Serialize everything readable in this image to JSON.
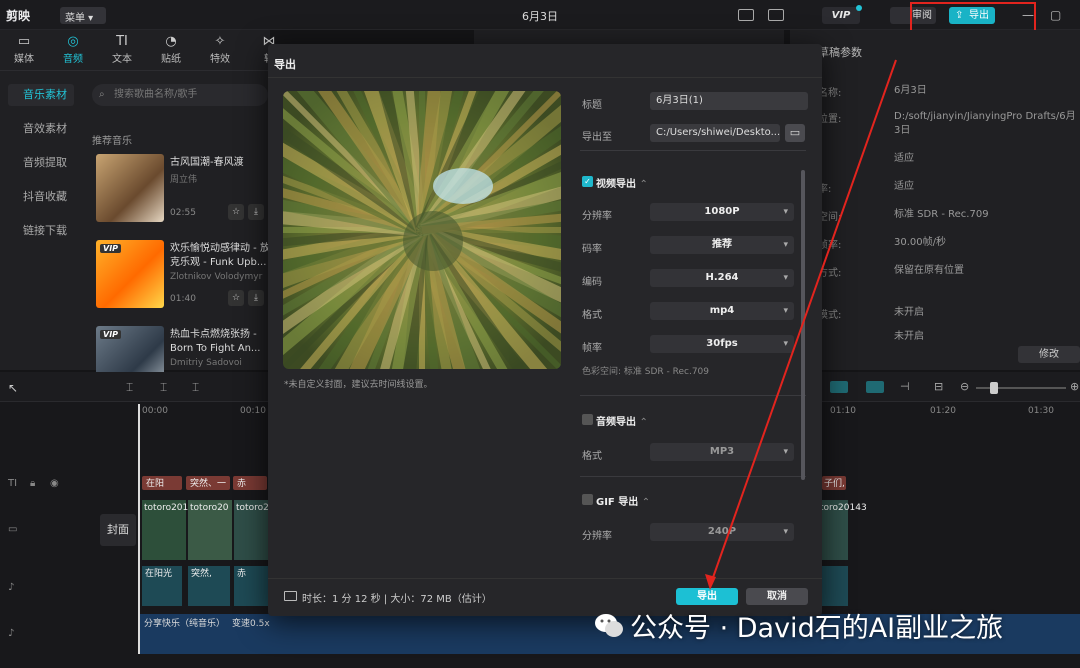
{
  "app": {
    "title": "6月3日",
    "logo": "剪映",
    "menu_label": "菜单",
    "vip_label": "VIP",
    "review_label": "审阅",
    "export_label": "导出",
    "accent": "#22c3d6",
    "highlight_red": "#e2241e"
  },
  "toolbar": {
    "tools": [
      {
        "label": "媒体",
        "icon": "media-icon"
      },
      {
        "label": "音频",
        "icon": "audio-icon"
      },
      {
        "label": "文本",
        "icon": "text-icon"
      },
      {
        "label": "贴纸",
        "icon": "sticker-icon"
      },
      {
        "label": "特效",
        "icon": "effects-icon"
      },
      {
        "label": "转",
        "icon": "transition-icon"
      }
    ]
  },
  "sidebar": {
    "items": [
      {
        "label": "音乐素材"
      },
      {
        "label": "音效素材"
      },
      {
        "label": "音频提取"
      },
      {
        "label": "抖音收藏"
      },
      {
        "label": "链接下载"
      }
    ]
  },
  "music": {
    "search_placeholder": "搜索歌曲名称/歌手",
    "section_title": "推荐音乐",
    "items": [
      {
        "title": "古风国潮-春风渡",
        "artist": "周立伟",
        "duration": "02:55",
        "vip": ""
      },
      {
        "title": "欢乐愉悦动感律动 - 放克乐观 - Funk Upb...",
        "artist": "Zlotnikov Volodymyr",
        "duration": "01:40",
        "vip": "VIP"
      },
      {
        "title": "热血卡点燃烧张扬 - Born To Fight An...",
        "artist": "Dmitriy Sadovoi",
        "duration": "",
        "vip": "VIP"
      }
    ]
  },
  "right_panel": {
    "title": "草稿参数",
    "rows": [
      {
        "label": "名称:",
        "value": "6月3日"
      },
      {
        "label": "位置:",
        "value": "D:/soft/jianyin/JianyingPro Drafts/6月3日"
      },
      {
        "label": "",
        "value": "适应"
      },
      {
        "label": "率:",
        "value": "适应"
      },
      {
        "label": "空间:",
        "value": "标准 SDR - Rec.709"
      },
      {
        "label": "帧率:",
        "value": "30.00帧/秒"
      },
      {
        "label": "方式:",
        "value": "保留在原有位置"
      },
      {
        "label": "模式:",
        "value": "未开启"
      },
      {
        "label": "",
        "value": "未开启"
      }
    ],
    "modify_label": "修改"
  },
  "timeline": {
    "ruler": [
      "00:00",
      "00:10",
      "01:10",
      "01:20",
      "01:30"
    ],
    "cover_label": "封面",
    "text_clips": [
      "在阳",
      "突然、一",
      "赤"
    ],
    "video_clips": [
      "totoro201",
      "totoro20",
      "totoro2"
    ],
    "sub_clips": [
      "在阳光",
      "突然,",
      "赤"
    ],
    "right_clip_text": "子们,",
    "right_video": "toro20143",
    "audio_clip": "分享快乐（纯音乐）",
    "speed_label": "变速0.5x"
  },
  "dialog": {
    "title": "导出",
    "cover_note": "*未自定义封面，建议去时间线设置。",
    "fields": {
      "title_label": "标题",
      "title_value": "6月3日(1)",
      "path_label": "导出至",
      "path_value": "C:/Users/shiwei/Deskto..."
    },
    "video_section": {
      "label": "视频导出",
      "checked": true,
      "rows": [
        {
          "label": "分辨率",
          "value": "1080P"
        },
        {
          "label": "码率",
          "value": "推荐"
        },
        {
          "label": "编码",
          "value": "H.264"
        },
        {
          "label": "格式",
          "value": "mp4"
        },
        {
          "label": "帧率",
          "value": "30fps"
        }
      ],
      "color_space": "色彩空间:  标准 SDR - Rec.709"
    },
    "audio_section": {
      "label": "音频导出",
      "checked": false,
      "format_label": "格式",
      "format_value": "MP3"
    },
    "gif_section": {
      "label": "GIF 导出",
      "checked": false,
      "res_label": "分辨率",
      "res_value": "240P"
    },
    "footer": {
      "info": "时长：1 分 12 秒 | 大小：72 MB（估计）",
      "export_label": "导出",
      "cancel_label": "取消"
    }
  },
  "watermark": "公众号 · David石的AI副业之旅"
}
